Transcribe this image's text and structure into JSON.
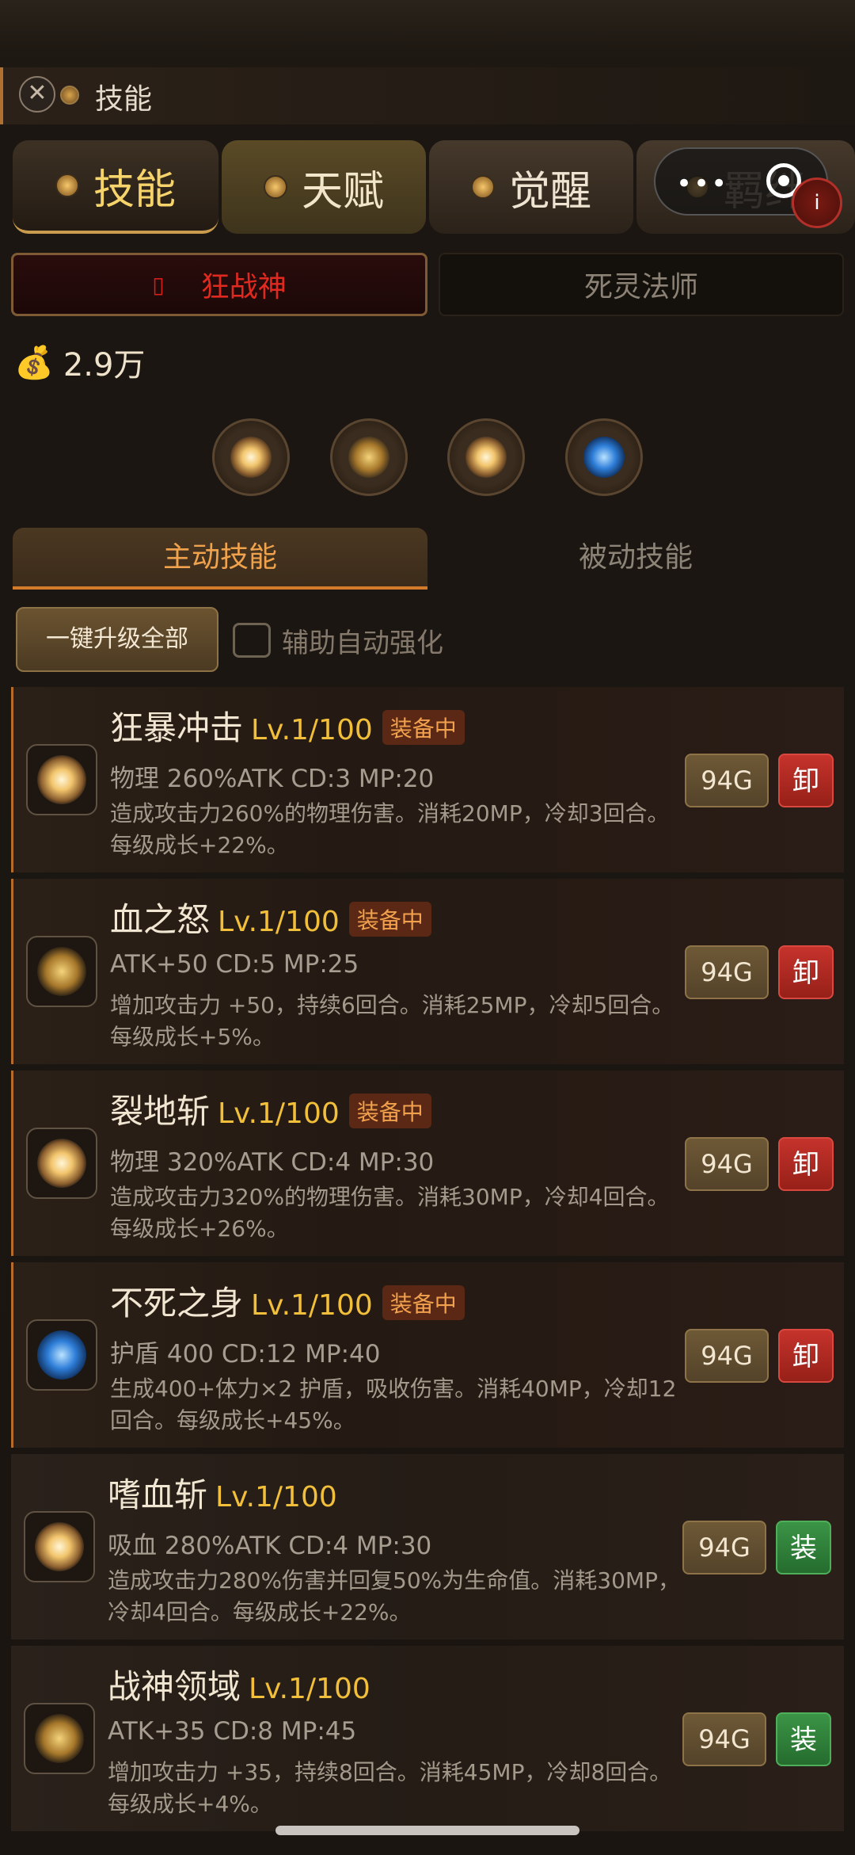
{
  "window": {
    "title": "技能",
    "close_glyph": "✕"
  },
  "tabs": [
    {
      "label": "技能",
      "icon": "medal-icon"
    },
    {
      "label": "天赋",
      "icon": "star-icon"
    },
    {
      "label": "觉醒",
      "icon": "flame-icon"
    },
    {
      "label": "羁绊",
      "icon": "link-icon"
    }
  ],
  "miniprogram": {
    "dots": "•••",
    "info": "i"
  },
  "classes": {
    "active": "狂战神",
    "active_mark": "▯",
    "other": "死灵法师"
  },
  "gold": {
    "icon": "money-bag-icon",
    "glyph": "💰",
    "amount": "2.9万"
  },
  "equipped_slots": [
    "burst",
    "arrow",
    "burst",
    "blue"
  ],
  "subtabs": {
    "active": "主动技能",
    "inactive": "被动技能"
  },
  "actions": {
    "upgrade_all": "一键升级全部",
    "auto_label": "辅助自动强化",
    "auto_checked": false
  },
  "skills": [
    {
      "name": "狂暴冲击",
      "level": "Lv.1/100",
      "equipped_tag": "装备中",
      "stats": "物理 260%ATK  CD:3 MP:20",
      "desc": "造成攻击力260%的物理伤害。消耗20MP，冷却3回合。每级成长+22%。",
      "cost": "94G",
      "action": "卸",
      "icon": "burst"
    },
    {
      "name": "血之怒",
      "level": "Lv.1/100",
      "equipped_tag": "装备中",
      "stats": "ATK+50  CD:5 MP:25",
      "desc": "增加攻击力 +50，持续6回合。消耗25MP，冷却5回合。每级成长+5%。",
      "cost": "94G",
      "action": "卸",
      "icon": "arrow"
    },
    {
      "name": "裂地斩",
      "level": "Lv.1/100",
      "equipped_tag": "装备中",
      "stats": "物理 320%ATK  CD:4 MP:30",
      "desc": "造成攻击力320%的物理伤害。消耗30MP，冷却4回合。每级成长+26%。",
      "cost": "94G",
      "action": "卸",
      "icon": "burst"
    },
    {
      "name": "不死之身",
      "level": "Lv.1/100",
      "equipped_tag": "装备中",
      "stats": "护盾 400  CD:12 MP:40",
      "desc": "生成400+体力×2 护盾，吸收伤害。消耗40MP，冷却12回合。每级成长+45%。",
      "cost": "94G",
      "action": "卸",
      "icon": "blue"
    },
    {
      "name": "嗜血斩",
      "level": "Lv.1/100",
      "equipped_tag": "",
      "stats": "吸血 280%ATK  CD:4 MP:30",
      "desc": "造成攻击力280%伤害并回复50%为生命值。消耗30MP，冷却4回合。每级成长+22%。",
      "cost": "94G",
      "action": "装",
      "icon": "burst"
    },
    {
      "name": "战神领域",
      "level": "Lv.1/100",
      "equipped_tag": "",
      "stats": "ATK+35  CD:8 MP:45",
      "desc": "增加攻击力 +35，持续8回合。消耗45MP，冷却8回合。每级成长+4%。",
      "cost": "94G",
      "action": "装",
      "icon": "arrow"
    }
  ]
}
